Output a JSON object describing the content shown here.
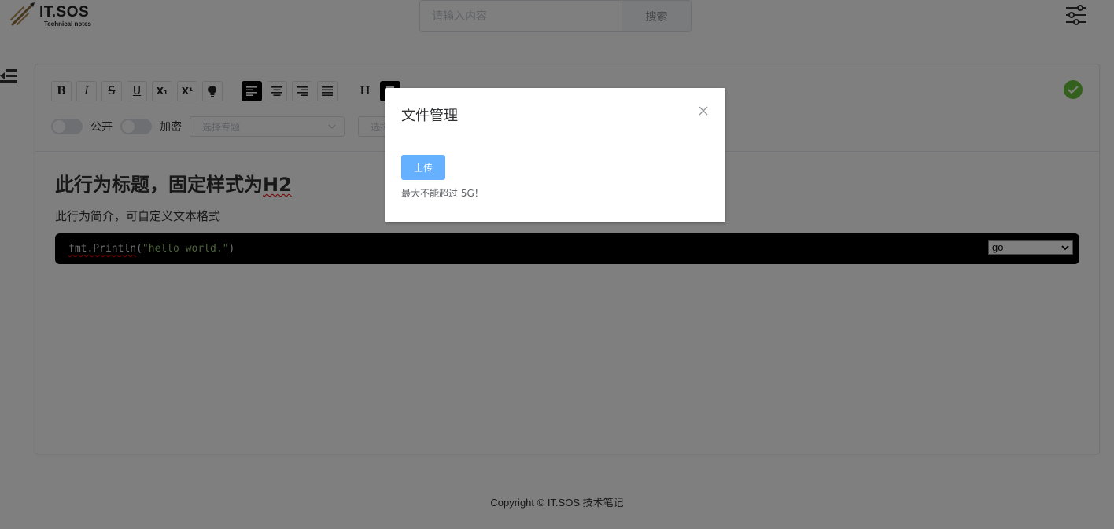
{
  "header": {
    "logo_title": "IT.SOS",
    "logo_subtitle": "Technical notes",
    "search_placeholder": "请输入内容",
    "search_button": "搜索"
  },
  "toolbar": {
    "buttons": [
      "B",
      "I",
      "S",
      "U",
      "X₁",
      "X¹",
      "lightbulb",
      "align-left",
      "align-center",
      "align-right",
      "align-justify",
      "H",
      "paragraph"
    ],
    "public_label": "公开",
    "encrypt_label": "加密",
    "topic_placeholder": "选择专题",
    "second_placeholder": "选择"
  },
  "content": {
    "title_prefix": "此行为标题，固定样式为",
    "title_suffix": "H2",
    "intro": "此行为简介，可自定义文本格式",
    "code": {
      "fn": "fmt.Println",
      "open": "(",
      "string": "\"hello world.\"",
      "close": ")",
      "language": "go"
    }
  },
  "footer": {
    "copyright": "Copyright © IT.SOS 技术笔记"
  },
  "dialog": {
    "title": "文件管理",
    "upload_button": "上传",
    "tip": "最大不能超过 5G！"
  },
  "colors": {
    "success": "#67c23a",
    "upload": "#66b1ff",
    "overlay": "rgba(0,0,0,0.5)"
  }
}
